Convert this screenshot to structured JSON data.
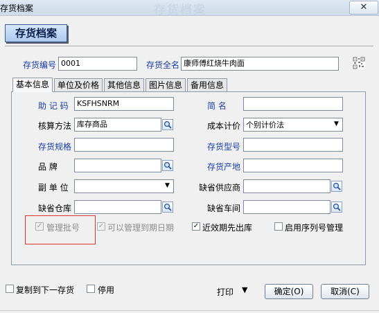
{
  "window": {
    "title": "存货档案",
    "ghost_title": "存货档案",
    "close": "✕"
  },
  "header": {
    "badge": "存货档案"
  },
  "top": {
    "code_label": "存货编号",
    "code_value": "0001",
    "fullname_label": "存货全名",
    "fullname_value": "康师傅红烧牛肉面",
    "qr_icon": "qr-code-icon"
  },
  "tabs": [
    "基本信息",
    "单位及价格",
    "其他信息",
    "图片信息",
    "备用信息"
  ],
  "active_tab": "基本信息",
  "form": {
    "mnemonic_label": "助 记 码",
    "mnemonic_value": "KSFHSNRM",
    "short_label": "简    名",
    "short_value": "",
    "accounting_label": "核算方法",
    "accounting_value": "库存商品",
    "costing_label": "成本计价",
    "costing_value": "个别计价法",
    "spec_label": "存货规格",
    "spec_value": "",
    "model_label": "存货型号",
    "model_value": "",
    "brand_label": "品    牌",
    "brand_value": "",
    "origin_label": "存货产地",
    "origin_value": "",
    "subunit_label": "副 单 位",
    "subunit_value": "",
    "supplier_label": "缺省供应商",
    "supplier_value": "",
    "warehouse_label": "缺省仓库",
    "warehouse_value": "",
    "workshop_label": "缺省车间",
    "workshop_value": ""
  },
  "checks": {
    "batch": {
      "label": "管理批号",
      "checked": true,
      "disabled": true
    },
    "expiry": {
      "label": "可以管理到期日期",
      "checked": true,
      "disabled": true
    },
    "near_expiry": {
      "label": "近效期先出库",
      "checked": true,
      "disabled": false
    },
    "serial": {
      "label": "启用序列号管理",
      "checked": false,
      "disabled": false
    }
  },
  "footer": {
    "copy_next": "复制到下一存货",
    "disable": "停用",
    "print": "打印",
    "print_arrow": "▼",
    "ok": "确定(O)",
    "cancel": "取消(C)"
  },
  "colors": {
    "label_blue": "#1a3fa8",
    "highlight_red": "#dd3333"
  }
}
